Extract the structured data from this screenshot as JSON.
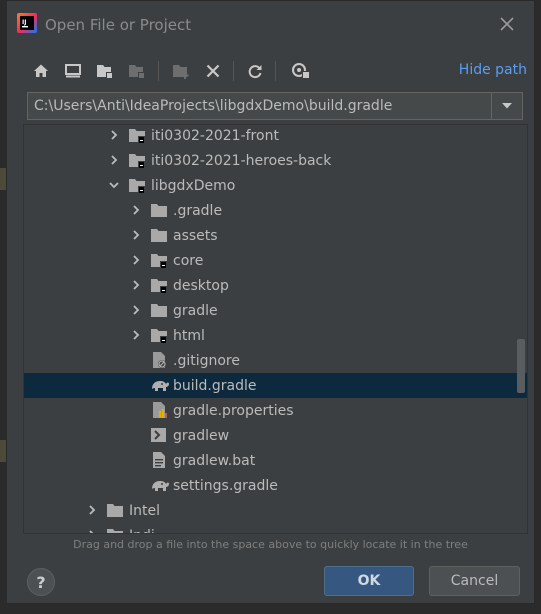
{
  "window": {
    "title": "Open File or Project",
    "app_icon": "intellij-idea-icon",
    "close_icon": "close-icon"
  },
  "toolbar": {
    "buttons": [
      {
        "icon": "home-icon",
        "tooltip": "Home directory"
      },
      {
        "icon": "desktop-icon",
        "tooltip": "Desktop directory"
      },
      {
        "icon": "project-folder-icon",
        "tooltip": "Project directory"
      },
      {
        "icon": "module-folder-icon",
        "tooltip": "Module directory"
      },
      {
        "icon": "new-folder-icon",
        "tooltip": "New directory"
      },
      {
        "icon": "delete-icon",
        "tooltip": "Delete"
      },
      {
        "icon": "refresh-icon",
        "tooltip": "Refresh"
      },
      {
        "icon": "show-hidden-icon",
        "tooltip": "Show hidden files"
      }
    ],
    "hide_path_label": "Hide path"
  },
  "path": {
    "value": "C:\\Users\\Anti\\IdeaProjects\\libgdxDemo\\build.gradle",
    "dropdown_icon": "chevron-down-icon"
  },
  "tree": {
    "items": [
      {
        "label": "iti0302-2021-front",
        "depth": 3,
        "expandable": true,
        "expanded": false,
        "icon": "module-folder-icon",
        "selected": false
      },
      {
        "label": "iti0302-2021-heroes-back",
        "depth": 3,
        "expandable": true,
        "expanded": false,
        "icon": "module-folder-icon",
        "selected": false
      },
      {
        "label": "libgdxDemo",
        "depth": 3,
        "expandable": true,
        "expanded": true,
        "icon": "module-folder-icon",
        "selected": false
      },
      {
        "label": ".gradle",
        "depth": 4,
        "expandable": true,
        "expanded": false,
        "icon": "folder-icon",
        "selected": false
      },
      {
        "label": "assets",
        "depth": 4,
        "expandable": true,
        "expanded": false,
        "icon": "folder-icon",
        "selected": false
      },
      {
        "label": "core",
        "depth": 4,
        "expandable": true,
        "expanded": false,
        "icon": "module-folder-icon",
        "selected": false
      },
      {
        "label": "desktop",
        "depth": 4,
        "expandable": true,
        "expanded": false,
        "icon": "module-folder-icon",
        "selected": false
      },
      {
        "label": "gradle",
        "depth": 4,
        "expandable": true,
        "expanded": false,
        "icon": "folder-icon",
        "selected": false
      },
      {
        "label": "html",
        "depth": 4,
        "expandable": true,
        "expanded": false,
        "icon": "module-folder-icon",
        "selected": false
      },
      {
        "label": ".gitignore",
        "depth": 4,
        "expandable": false,
        "expanded": false,
        "icon": "gitignore-file-icon",
        "selected": false
      },
      {
        "label": "build.gradle",
        "depth": 4,
        "expandable": false,
        "expanded": false,
        "icon": "gradle-file-icon",
        "selected": true
      },
      {
        "label": "gradle.properties",
        "depth": 4,
        "expandable": false,
        "expanded": false,
        "icon": "properties-file-icon",
        "selected": false
      },
      {
        "label": "gradlew",
        "depth": 4,
        "expandable": false,
        "expanded": false,
        "icon": "shell-script-icon",
        "selected": false
      },
      {
        "label": "gradlew.bat",
        "depth": 4,
        "expandable": false,
        "expanded": false,
        "icon": "text-file-icon",
        "selected": false
      },
      {
        "label": "settings.gradle",
        "depth": 4,
        "expandable": false,
        "expanded": false,
        "icon": "gradle-file-icon",
        "selected": false
      },
      {
        "label": "Intel",
        "depth": 2,
        "expandable": true,
        "expanded": false,
        "icon": "folder-icon",
        "selected": false
      },
      {
        "label": "Indi",
        "depth": 2,
        "expandable": true,
        "expanded": false,
        "icon": "folder-icon",
        "selected": false
      }
    ]
  },
  "hint": "Drag and drop a file into the space above to quickly locate it in the tree",
  "footer": {
    "help_label": "?",
    "ok_label": "OK",
    "cancel_label": "Cancel"
  },
  "colors": {
    "background": "#3c3f41",
    "selection": "#0d293e",
    "link": "#589df6",
    "primary_button": "#365880"
  }
}
